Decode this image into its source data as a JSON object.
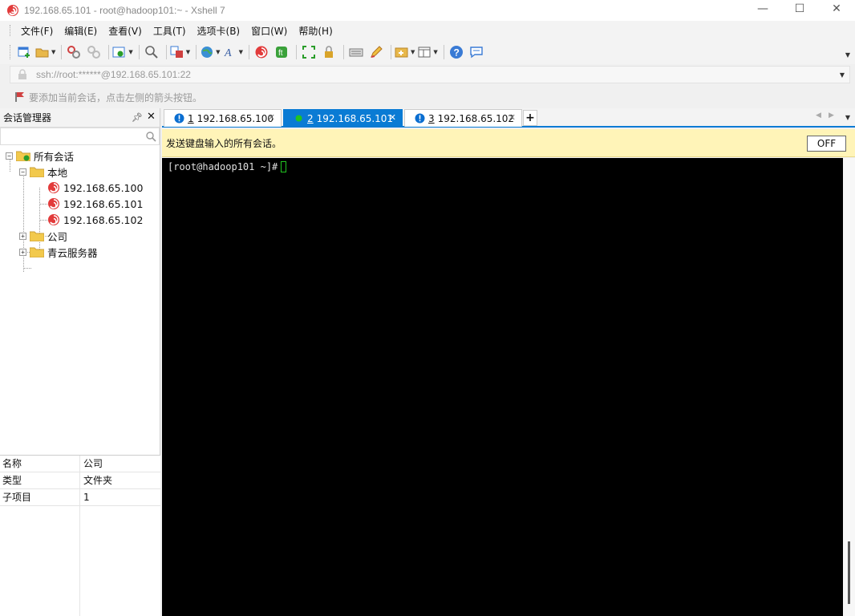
{
  "window": {
    "title": "192.168.65.101 - root@hadoop101:~ - Xshell 7",
    "minimize": "—",
    "maximize": "☐",
    "close": "✕"
  },
  "menu": [
    {
      "label": "文件(F)"
    },
    {
      "label": "编辑(E)"
    },
    {
      "label": "查看(V)"
    },
    {
      "label": "工具(T)"
    },
    {
      "label": "选项卡(B)"
    },
    {
      "label": "窗口(W)"
    },
    {
      "label": "帮助(H)"
    }
  ],
  "address": {
    "value": "ssh://root:******@192.168.65.101:22"
  },
  "hint": {
    "text": "要添加当前会话，点击左侧的箭头按钮。"
  },
  "session_manager": {
    "title": "会话管理器",
    "tree": {
      "root": "所有会话",
      "local": "本地",
      "sessions": [
        "192.168.65.100",
        "192.168.65.101",
        "192.168.65.102"
      ],
      "company": "公司",
      "qingcloud": "青云服务器"
    },
    "properties": [
      {
        "key": "名称",
        "value": "公司"
      },
      {
        "key": "类型",
        "value": "文件夹"
      },
      {
        "key": "子项目",
        "value": "1"
      }
    ]
  },
  "tabs": [
    {
      "num": "1",
      "label": "192.168.65.100"
    },
    {
      "num": "2",
      "label": "192.168.65.101"
    },
    {
      "num": "3",
      "label": "192.168.65.102"
    }
  ],
  "tab_add": "+",
  "sendbar": {
    "text": "发送键盘输入的所有会话。",
    "button": "OFF"
  },
  "terminal": {
    "prompt": "[root@hadoop101 ~]#"
  },
  "colors": {
    "accent": "#0a7bd4",
    "connected": "#21c421",
    "warning": "#0a6ed1",
    "sendbar_bg": "#fff4b8"
  }
}
